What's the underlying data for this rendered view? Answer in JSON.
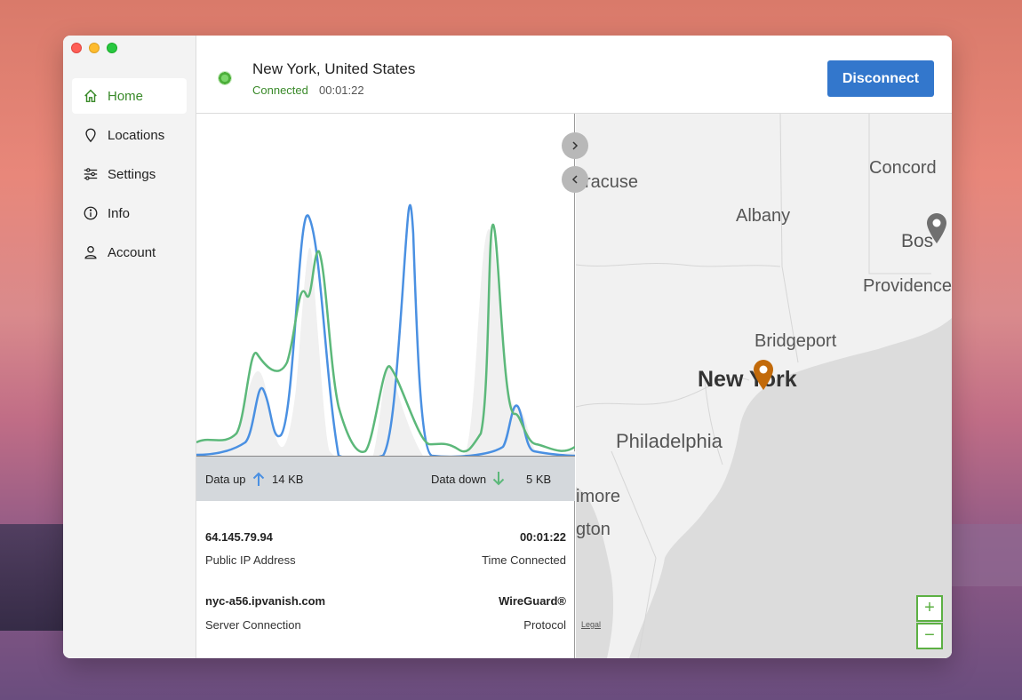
{
  "sidebar": {
    "items": [
      {
        "label": "Home",
        "icon": "home-icon",
        "active": true
      },
      {
        "label": "Locations",
        "icon": "location-pin-icon"
      },
      {
        "label": "Settings",
        "icon": "sliders-icon"
      },
      {
        "label": "Info",
        "icon": "info-icon"
      },
      {
        "label": "Account",
        "icon": "user-icon"
      }
    ]
  },
  "header": {
    "location": "New York, United States",
    "status": "Connected",
    "elapsed": "00:01:22",
    "disconnect_label": "Disconnect"
  },
  "stats": {
    "up_label": "Data up",
    "up_value": "14 KB",
    "down_label": "Data down",
    "down_value": "5 KB"
  },
  "info": {
    "ip": "64.145.79.94",
    "ip_caption": "Public IP Address",
    "time": "00:01:22",
    "time_caption": "Time Connected",
    "server": "nyc-a56.ipvanish.com",
    "server_caption": "Server Connection",
    "protocol": "WireGuard®",
    "protocol_caption": "Protocol"
  },
  "map": {
    "labels": [
      "yracuse",
      "Concord",
      "Albany",
      "Bos",
      "Providence",
      "Bridgeport",
      "New York",
      "Philadelphia",
      "imore",
      "gton"
    ],
    "legal": "Legal",
    "zoom_in": "+",
    "zoom_out": "−"
  },
  "colors": {
    "accent": "#3a8a2a",
    "button": "#3377cc",
    "upload_line": "#4a90e2",
    "download_line": "#5cb87a"
  }
}
